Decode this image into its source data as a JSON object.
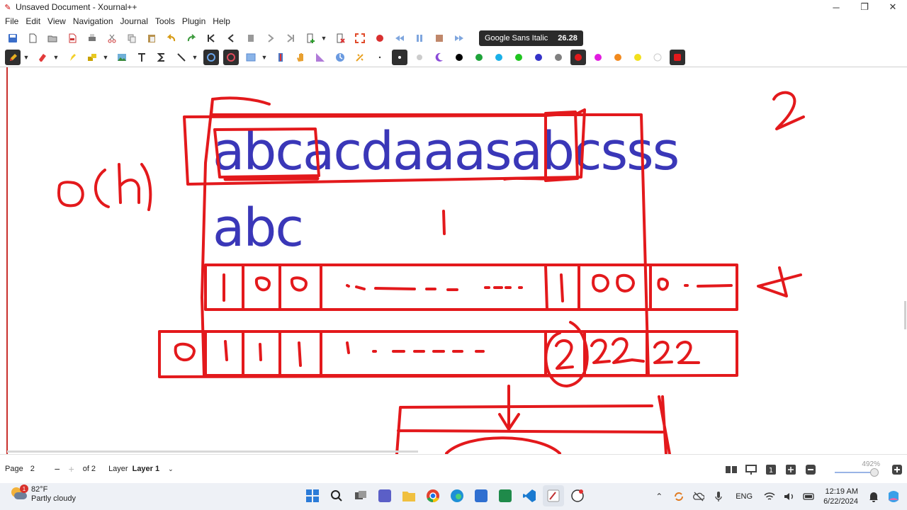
{
  "window": {
    "title": "Unsaved Document - Xournal++",
    "minimize": "─",
    "maximize": "❐",
    "close": "✕"
  },
  "menu": {
    "items": [
      "File",
      "Edit",
      "View",
      "Navigation",
      "Journal",
      "Tools",
      "Plugin",
      "Help"
    ]
  },
  "toolbar": {
    "font_name": "Google Sans Italic",
    "font_size": "26.28"
  },
  "colors": {
    "ink_red": "#e3191c",
    "text_blue": "#3a37b8",
    "palette": [
      "#000000",
      "#1fa33a",
      "#1ab0e8",
      "#20c520",
      "#3432c8",
      "#808080",
      "#e3191c",
      "#e21ce0",
      "#f28a1e",
      "#f2e01c",
      "#ffffff",
      "#e3191c"
    ]
  },
  "canvas": {
    "typed_text_line1": "abcacdaaasabcsss",
    "typed_text_line2": "abc"
  },
  "statusbar": {
    "page_label": "Page",
    "page_value": "2",
    "of_pages": "of 2",
    "layer_label": "Layer",
    "layer_name": "Layer 1",
    "zoom": "492%",
    "page_num_badge": "1"
  },
  "taskbar": {
    "temperature": "82°F",
    "weather": "Partly cloudy",
    "weather_badge": "1",
    "language": "ENG",
    "time": "12:19 AM",
    "date": "6/22/2024"
  }
}
